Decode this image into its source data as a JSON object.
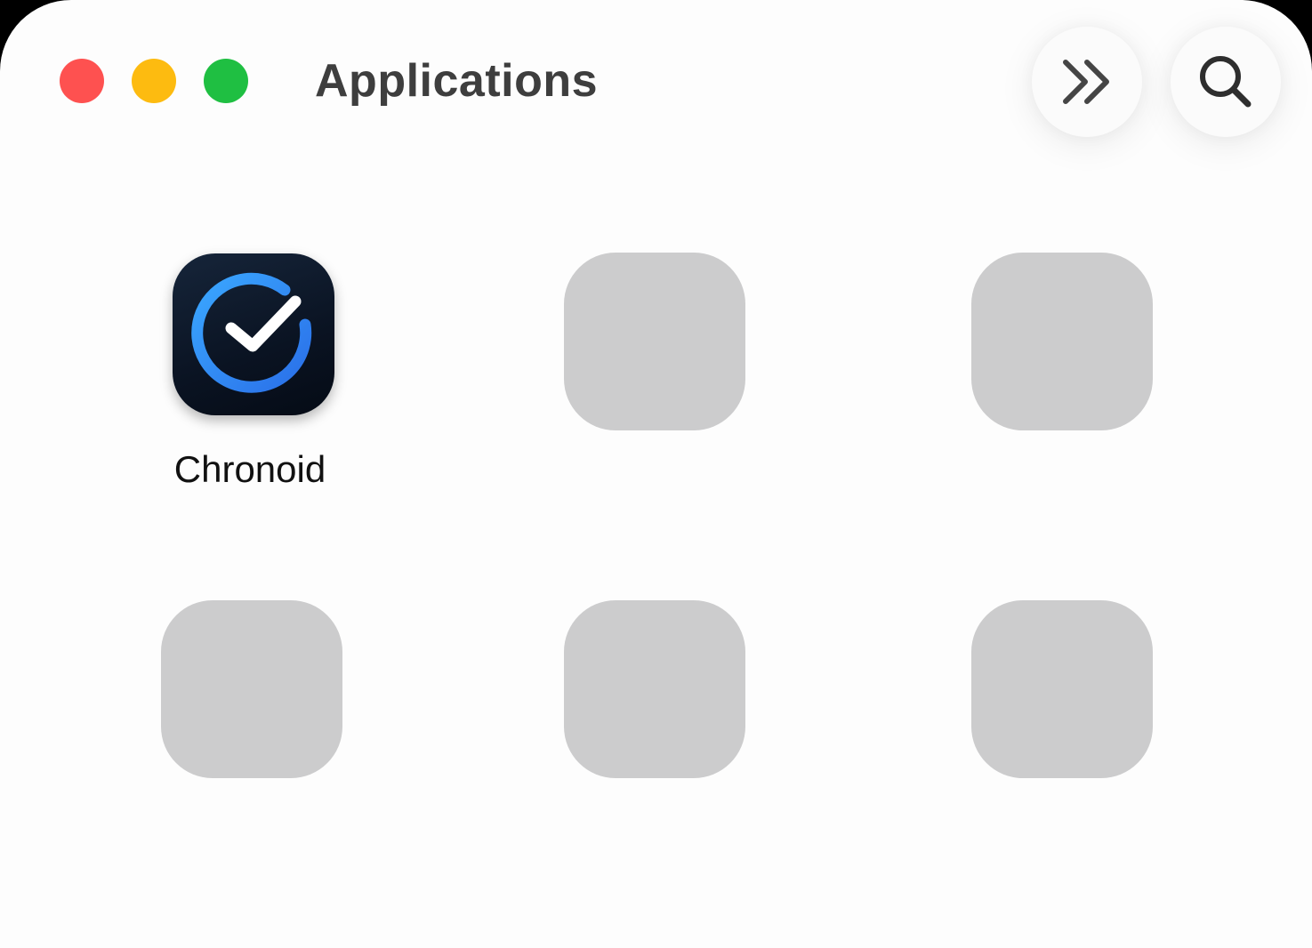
{
  "window": {
    "title": "Applications"
  },
  "toolbar": {
    "forward_icon": "chevron-double-right-icon",
    "search_icon": "search-icon"
  },
  "apps": [
    {
      "name": "Chronoid",
      "icon": "clock-checkmark-icon"
    },
    {
      "name": "",
      "placeholder": true
    },
    {
      "name": "",
      "placeholder": true
    },
    {
      "name": "",
      "placeholder": true
    },
    {
      "name": "",
      "placeholder": true
    },
    {
      "name": "",
      "placeholder": true
    }
  ],
  "colors": {
    "close": "#fe5150",
    "minimize": "#fdbb10",
    "maximize": "#1fbf42",
    "placeholder_tile": "#cccccd",
    "chronoid_accent": "#2f8ff5"
  }
}
